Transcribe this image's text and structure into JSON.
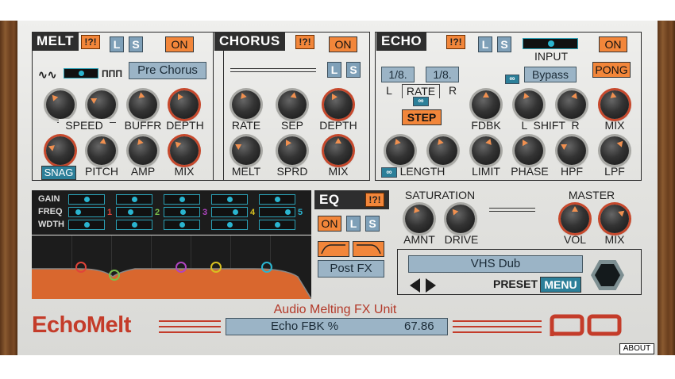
{
  "melt": {
    "title": "MELT",
    "excl": "!?!",
    "l": "L",
    "s": "S",
    "on": "ON",
    "mode": "Pre Chorus",
    "knobs": [
      "SPEED",
      "BUFFR",
      "DEPTH",
      "PITCH",
      "AMP",
      "MIX"
    ],
    "snag": "SNAG"
  },
  "chorus": {
    "title": "CHORUS",
    "excl": "!?!",
    "on": "ON",
    "l": "L",
    "s": "S",
    "knobs": [
      "RATE",
      "SEP",
      "DEPTH",
      "MELT",
      "SPRD",
      "MIX"
    ]
  },
  "echo": {
    "title": "ECHO",
    "excl": "!?!",
    "l": "L",
    "s": "S",
    "on": "ON",
    "input": "INPUT",
    "pong": "PONG",
    "bypass": "Bypass",
    "rate_l": "1/8.",
    "rate_r": "1/8.",
    "rate": "RATE",
    "l_side": "L",
    "r_side": "R",
    "step": "STEP",
    "knobs": [
      "FDBK",
      "L  SHIFT  R",
      "MIX",
      "LENGTH",
      "LIMIT",
      "PHASE",
      "HPF",
      "LPF"
    ]
  },
  "eq": {
    "title": "EQ",
    "excl": "!?!",
    "on": "ON",
    "l": "L",
    "s": "S",
    "rows": [
      "GAIN",
      "FREQ",
      "WDTH"
    ],
    "bands": [
      "1",
      "2",
      "3",
      "4",
      "5"
    ],
    "band_colors": [
      "#e0443a",
      "#7ac04a",
      "#b044c0",
      "#d8c020",
      "#2ab5d0"
    ],
    "post": "Post FX"
  },
  "saturation": {
    "title": "SATURATION",
    "knobs": [
      "AMNT",
      "DRIVE"
    ]
  },
  "master": {
    "title": "MASTER",
    "knobs": [
      "VOL",
      "MIX"
    ]
  },
  "preset": {
    "name": "VHS Dub",
    "label": "PRESET",
    "menu": "MENU"
  },
  "footer": {
    "brand": "EchoMelt",
    "subtitle": "Audio Melting FX Unit",
    "param": "Echo FBK %",
    "value": "67.86",
    "about": "ABOUT"
  }
}
